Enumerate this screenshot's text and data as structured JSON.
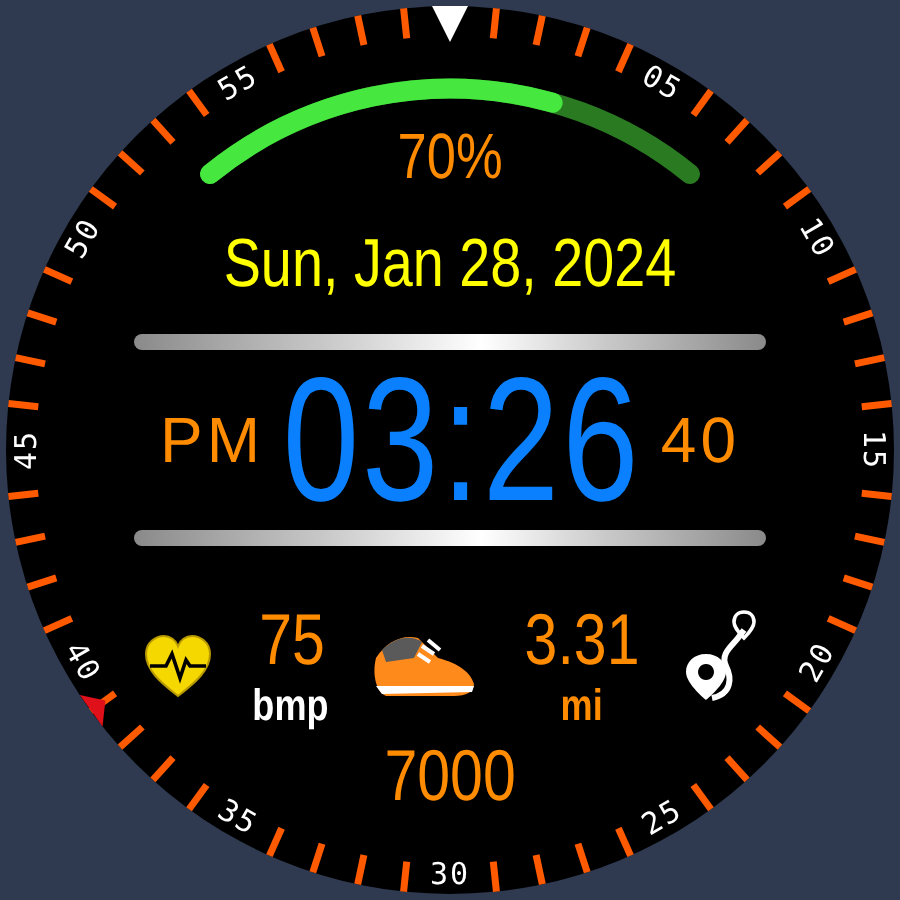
{
  "bezel": {
    "numbers": [
      "05",
      "10",
      "15",
      "20",
      "25",
      "30",
      "35",
      "40",
      "45",
      "50",
      "55"
    ]
  },
  "battery": {
    "reading": "70%"
  },
  "date": "Sun, Jan 28, 2024",
  "time": {
    "ampm": "PM",
    "hours_minutes": "03:26",
    "seconds": "40"
  },
  "heart_rate": {
    "value": "75",
    "unit": "bmp"
  },
  "steps": {
    "value": "7000"
  },
  "distance": {
    "value": "3.31",
    "unit": "mi"
  }
}
